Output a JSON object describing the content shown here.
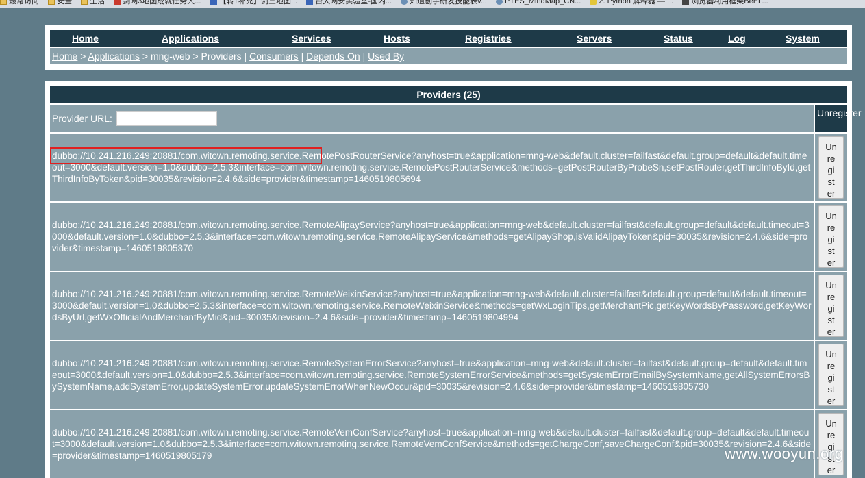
{
  "bookmarks": [
    {
      "icon": "folder-icon",
      "label": "最常访问"
    },
    {
      "icon": "folder-icon",
      "label": "安全"
    },
    {
      "icon": "folder-icon",
      "label": "生活"
    },
    {
      "icon": "red-site-icon",
      "label": "剑网3地图成就任务大..."
    },
    {
      "icon": "blue-site-icon",
      "label": "【转+补充】剑三地图..."
    },
    {
      "icon": "shield-site-icon",
      "label": "台大网安实验室-国内..."
    },
    {
      "icon": "globe-icon",
      "label": "知道创宇研发技能表v..."
    },
    {
      "icon": "globe-icon",
      "label": "PTES_MindMap_CN..."
    },
    {
      "icon": "python-icon",
      "label": "2. Python 解释器 — ..."
    },
    {
      "icon": "dark-site-icon",
      "label": "浏览器利用框架BeEF..."
    }
  ],
  "nav": {
    "menu": [
      "Home",
      "Applications",
      "Services",
      "Hosts",
      "Registries",
      "Servers",
      "Status",
      "Log",
      "System"
    ],
    "breadcrumb": {
      "home": "Home",
      "sep1": " > ",
      "applications": "Applications",
      "sep2": " > mng-web > Providers | ",
      "consumers": "Consumers",
      "sep3": " | ",
      "depends_on": "Depends On",
      "sep4": " | ",
      "used_by": "Used By"
    }
  },
  "providers": {
    "title": "Providers (25)",
    "url_label": "Provider URL:",
    "url_value": "",
    "unregister_header": "Unregister",
    "unregister_button": "Unregister",
    "rows": [
      "dubbo://10.241.216.249:20881/com.witown.remoting.service.RemotePostRouterService?anyhost=true&application=mng-web&default.cluster=failfast&default.group=default&default.timeout=3000&default.version=1.0&dubbo=2.5.3&interface=com.witown.remoting.service.RemotePostRouterService&methods=getPostRouterByProbeSn,setPostRouter,getThirdInfoById,getThirdInfoByToken&pid=30035&revision=2.4.6&side=provider&timestamp=1460519805694",
      "dubbo://10.241.216.249:20881/com.witown.remoting.service.RemoteAlipayService?anyhost=true&application=mng-web&default.cluster=failfast&default.group=default&default.timeout=3000&default.version=1.0&dubbo=2.5.3&interface=com.witown.remoting.service.RemoteAlipayService&methods=getAlipayShop,isValidAlipayToken&pid=30035&revision=2.4.6&side=provider&timestamp=1460519805370",
      "dubbo://10.241.216.249:20881/com.witown.remoting.service.RemoteWeixinService?anyhost=true&application=mng-web&default.cluster=failfast&default.group=default&default.timeout=3000&default.version=1.0&dubbo=2.5.3&interface=com.witown.remoting.service.RemoteWeixinService&methods=getWxLoginTips,getMerchantPic,getKeyWordsByPassword,getKeyWordsByUrl,getWxOfficialAndMerchantByMid&pid=30035&revision=2.4.6&side=provider&timestamp=1460519804994",
      "dubbo://10.241.216.249:20881/com.witown.remoting.service.RemoteSystemErrorService?anyhost=true&application=mng-web&default.cluster=failfast&default.group=default&default.timeout=3000&default.version=1.0&dubbo=2.5.3&interface=com.witown.remoting.service.RemoteSystemErrorService&methods=getSystemErrorEmailBySystemName,getAllSystemErrorsBySystemName,addSystemError,updateSystemError,updateSystemErrorWhenNewOccur&pid=30035&revision=2.4.6&side=provider&timestamp=1460519805730",
      "dubbo://10.241.216.249:20881/com.witown.remoting.service.RemoteVemConfService?anyhost=true&application=mng-web&default.cluster=failfast&default.group=default&default.timeout=3000&default.version=1.0&dubbo=2.5.3&interface=com.witown.remoting.service.RemoteVemConfService&methods=getChargeConf,saveChargeConf&pid=30035&revision=2.4.6&side=provider&timestamp=1460519805179"
    ]
  },
  "watermark": "www.wooyun.org"
}
